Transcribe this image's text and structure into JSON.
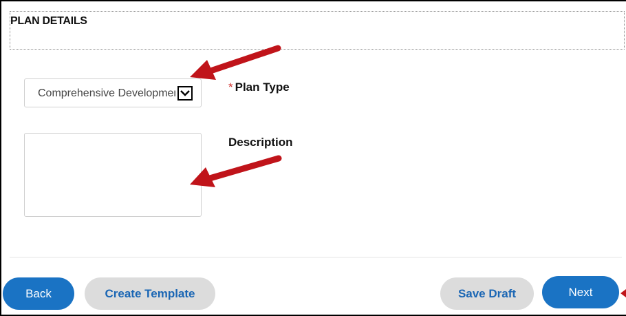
{
  "section": {
    "title": "PLAN DETAILS"
  },
  "form": {
    "plan_type": {
      "label": "Plan Type",
      "required_mark": "*",
      "selected_value": "Comprehensive Development"
    },
    "description": {
      "label": "Description",
      "value": ""
    }
  },
  "actions": {
    "back_label": "Back",
    "create_template_label": "Create Template",
    "save_draft_label": "Save Draft",
    "next_label": "Next"
  },
  "annotations": {
    "arrow_color": "#c0141a"
  },
  "icons": {
    "select_arrow": "chevron-down-icon"
  },
  "colors": {
    "primary_button": "#1a73c4",
    "secondary_button": "#dcdcdc",
    "secondary_text": "#1a66b4",
    "required": "#d0312d"
  }
}
